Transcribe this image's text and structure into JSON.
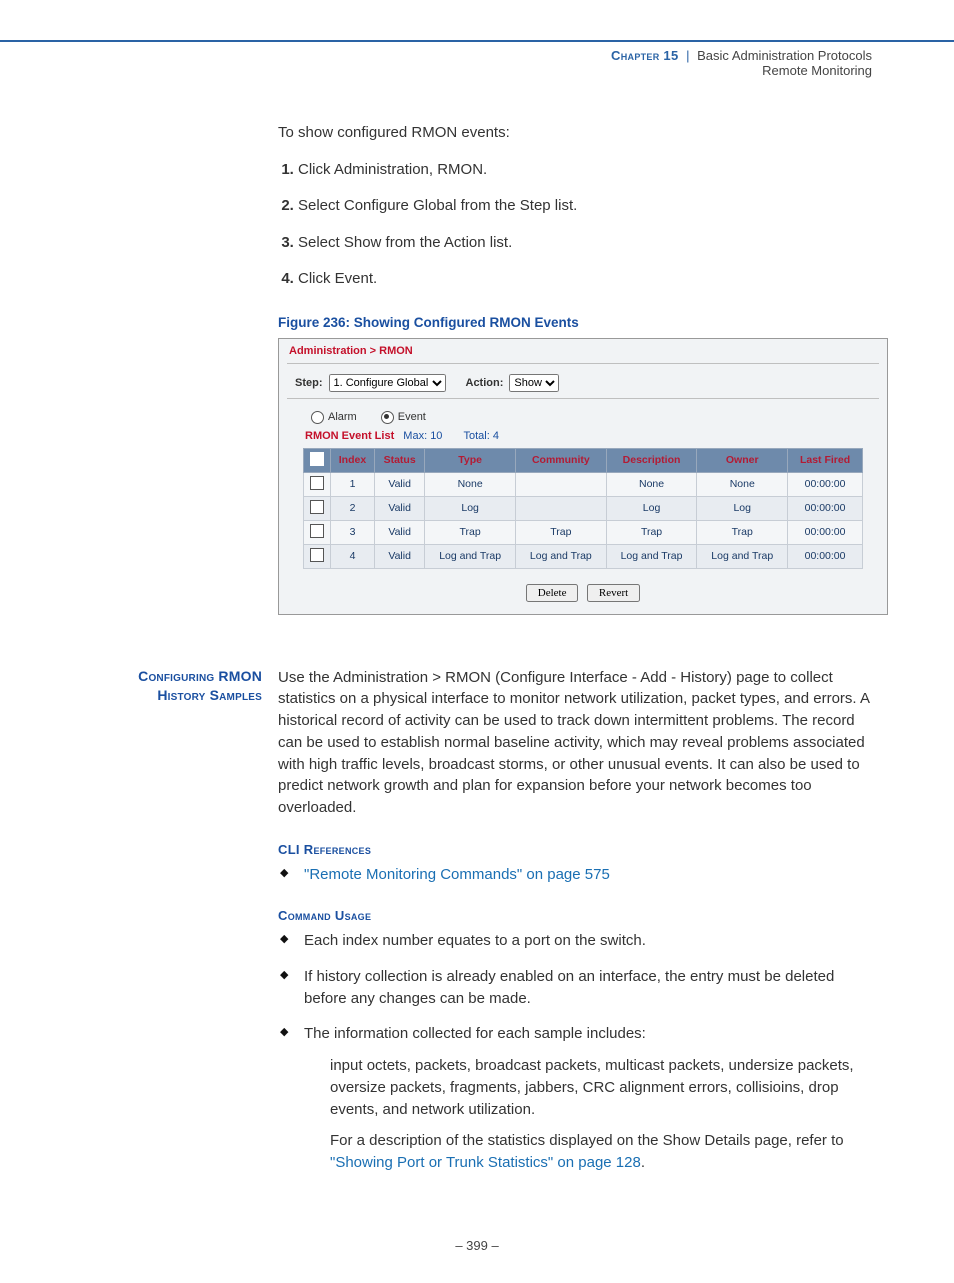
{
  "header": {
    "chapter": "Chapter 15",
    "separator": "|",
    "title1": "Basic Administration Protocols",
    "title2": "Remote Monitoring"
  },
  "intro": "To show configured RMON events:",
  "steps": [
    "Click Administration, RMON.",
    "Select Configure Global from the Step list.",
    "Select Show from the Action list.",
    "Click Event."
  ],
  "figure_caption": "Figure 236:  Showing Configured RMON Events",
  "ui": {
    "breadcrumb": "Administration > RMON",
    "step_label": "Step:",
    "step_value": "1. Configure Global",
    "action_label": "Action:",
    "action_value": "Show",
    "radio": {
      "alarm": "Alarm",
      "event": "Event"
    },
    "list_caption": {
      "title": "RMON Event List",
      "max": "Max: 10",
      "total": "Total: 4"
    },
    "columns": [
      "",
      "Index",
      "Status",
      "Type",
      "Community",
      "Description",
      "Owner",
      "Last Fired"
    ],
    "rows": [
      {
        "index": "1",
        "status": "Valid",
        "type": "None",
        "community": "",
        "desc": "None",
        "owner": "None",
        "fired": "00:00:00"
      },
      {
        "index": "2",
        "status": "Valid",
        "type": "Log",
        "community": "",
        "desc": "Log",
        "owner": "Log",
        "fired": "00:00:00"
      },
      {
        "index": "3",
        "status": "Valid",
        "type": "Trap",
        "community": "Trap",
        "desc": "Trap",
        "owner": "Trap",
        "fired": "00:00:00"
      },
      {
        "index": "4",
        "status": "Valid",
        "type": "Log and Trap",
        "community": "Log and Trap",
        "desc": "Log and Trap",
        "owner": "Log and Trap",
        "fired": "00:00:00"
      }
    ],
    "buttons": {
      "delete": "Delete",
      "revert": "Revert"
    }
  },
  "section2": {
    "sidehead_l1": "Configuring RMON",
    "sidehead_l2": "History Samples",
    "para": "Use the Administration > RMON (Configure Interface - Add - History) page to collect statistics on a physical interface to monitor network utilization, packet types, and errors. A historical record of activity can be used to track down intermittent problems. The record can be used to establish normal baseline activity, which may reveal problems associated with high traffic levels, broadcast storms, or other unusual events. It can also be used to predict network growth and plan for expansion before your network becomes too overloaded.",
    "cli_head": "CLI References",
    "cli_link": "\"Remote Monitoring Commands\" on page 575",
    "usage_head": "Command Usage",
    "usage": [
      "Each index number equates to a port on the switch.",
      "If history collection is already enabled on an interface, the entry must be deleted before any changes can be made.",
      "The information collected for each sample includes:"
    ],
    "sub1": "input octets, packets, broadcast packets, multicast packets, undersize packets, oversize packets, fragments, jabbers, CRC alignment errors, collisioins, drop events, and network utilization.",
    "sub2a": "For a description of the statistics displayed on the Show Details page, refer to ",
    "sub2link": "\"Showing Port or Trunk Statistics\" on page 128",
    "sub2b": "."
  },
  "pagenum": "–  399  –"
}
